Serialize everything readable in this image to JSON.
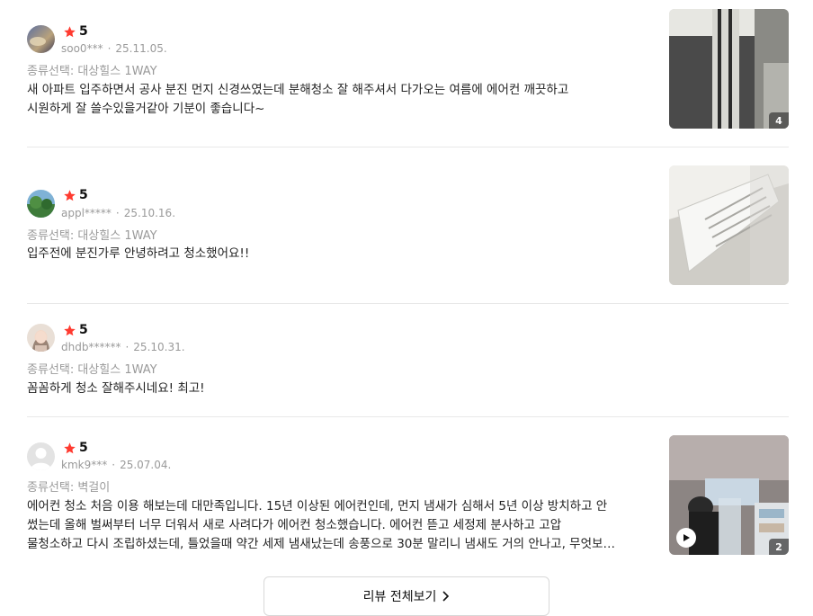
{
  "reviews": [
    {
      "rating": "5",
      "user": "soo0***",
      "date": "25.11.05.",
      "option": "종류선택: 대상힐스 1WAY",
      "text": "새 아파트 입주하면서 공사 분진 먼지 신경쓰였는데 분해청소 잘 해주셔서 다가오는 여름에 에어컨 깨끗하고\n시원하게 잘 쓸수있을거같아 기분이 좋습니다~",
      "photo_count": "4"
    },
    {
      "rating": "5",
      "user": "appl*****",
      "date": "25.10.16.",
      "option": "종류선택: 대상힐스 1WAY",
      "text": "입주전에 분진가루 안녕하려고 청소했어요!!"
    },
    {
      "rating": "5",
      "user": "dhdb******",
      "date": "25.10.31.",
      "option": "종류선택: 대상힐스 1WAY",
      "text": "꼼꼼하게 청소 잘해주시네요! 최고!"
    },
    {
      "rating": "5",
      "user": "kmk9***",
      "date": "25.07.04.",
      "option": "종류선택: 벽걸이",
      "text": "에어컨 청소 처음 이용 해보는데 대만족입니다. 15년 이상된 에어컨인데, 먼지 냄새가 심해서 5년 이상 방치하고 안\n썼는데 올해 벌써부터 너무 더워서 새로 사려다가 에어컨 청소했습니다. 에어컨 뜯고 세정제 분사하고 고압\n물청소하고 다시 조립하셨는데, 틀었을때 약간 세제 냄새났는데 송풍으로 30분 말리니 냄새도 거의 안나고, 무엇보…",
      "photo_count": "2"
    }
  ],
  "more_button": {
    "label": "리뷰 전체보기"
  },
  "colors": {
    "star": "#ff3b30",
    "meta": "#9a9a9a",
    "divider": "#e8e8e8"
  },
  "icons": {
    "star": "star-icon",
    "play": "play-icon",
    "chevron": "chevron-right-icon"
  }
}
